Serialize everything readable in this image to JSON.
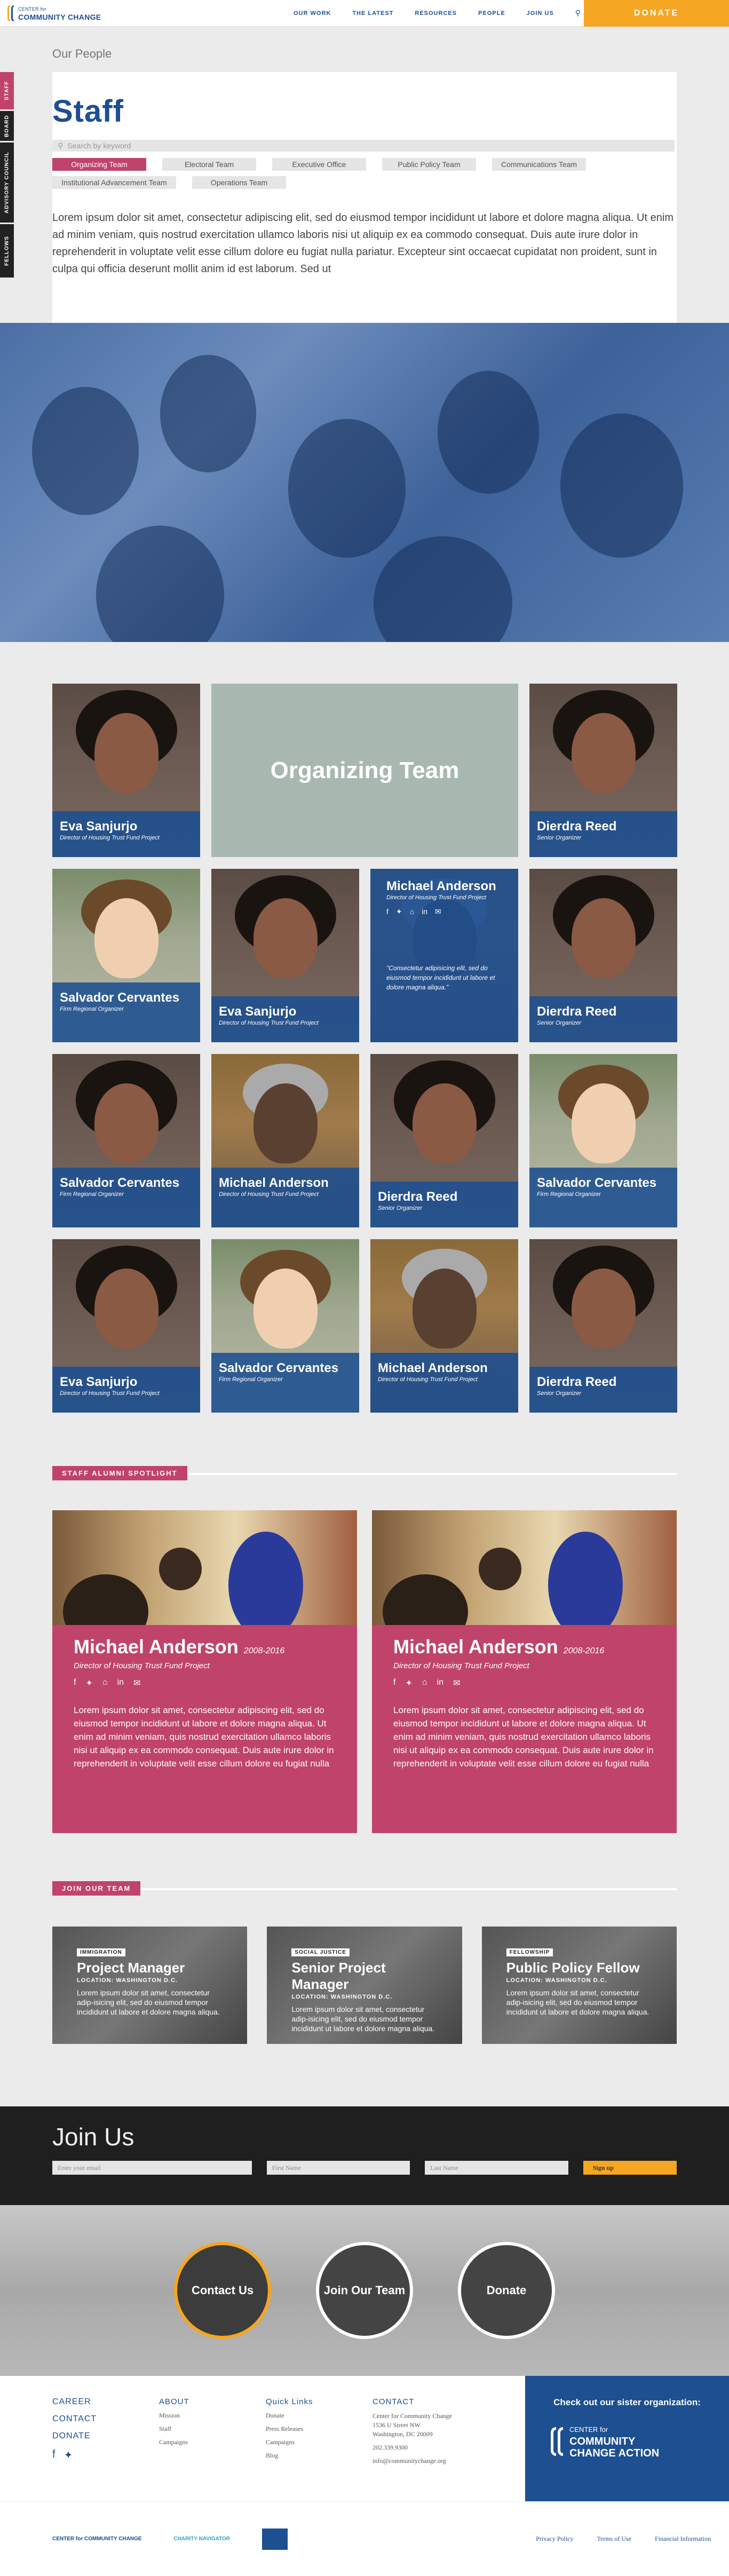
{
  "header": {
    "logo_line1": "CENTER for",
    "logo_line2": "COMMUNITY CHANGE",
    "nav": [
      "OUR WORK",
      "THE LATEST",
      "RESOURCES",
      "PEOPLE",
      "JOIN US"
    ],
    "donate_label": "DONATE"
  },
  "side_tabs": [
    "STAFF",
    "BOARD",
    "ADVISORY COUNCIL",
    "FELLOWS"
  ],
  "intro": {
    "breadcrumb": "Our People",
    "title": "Staff",
    "search_placeholder": "Search by keyword",
    "filters": [
      "Organizing Team",
      "Electoral Team",
      "Executive Office",
      "Public Policy Team",
      "Communications Team",
      "Institutional Advancement Team",
      "Operations Team"
    ],
    "body": "Lorem ipsum dolor sit amet, consectetur adipiscing elit, sed do eiusmod tempor incididunt ut labore et dolore magna aliqua. Ut enim ad minim veniam, quis nostrud exercitation ullamco laboris nisi ut aliquip ex ea commodo consequat. Duis aute irure dolor in reprehenderit in voluptate velit esse cillum dolore eu fugiat nulla pariatur. Excepteur sint occaecat cupidatat non proident, sunt in culpa qui officia deserunt mollit anim id est laborum. Sed ut"
  },
  "staff": {
    "team_title": "Organizing Team",
    "people": [
      {
        "name": "Eva Sanjurjo",
        "role": "Director of Housing Trust Fund Project"
      },
      {
        "name": "Dierdra Reed",
        "role": "Senior Organizer"
      },
      {
        "name": "Salvador Cervantes",
        "role": "Firm Regional Organizer"
      },
      {
        "name": "Eva Sanjurjo",
        "role": "Director of Housing Trust Fund Project"
      },
      {
        "name": "Michael Anderson",
        "role": "Director of Housing Trust Fund Project",
        "bio": "\"Consectetur adipisicing elit, sed do eiusmod tempor incididunt ut labore et dolore magna aliqua.\""
      },
      {
        "name": "Dierdra Reed",
        "role": "Senior Organizer"
      },
      {
        "name": "Salvador Cervantes",
        "role": "Firm Regional Organizer"
      },
      {
        "name": "Michael Anderson",
        "role": "Director of Housing Trust Fund Project"
      },
      {
        "name": "Dierdra Reed",
        "role": "Senior Organizer"
      },
      {
        "name": "Salvador Cervantes",
        "role": "Firm Regional Organizer"
      },
      {
        "name": "Eva Sanjurjo",
        "role": "Director of Housing Trust Fund Project"
      },
      {
        "name": "Salvador Cervantes",
        "role": "Firm Regional Organizer"
      },
      {
        "name": "Michael Anderson",
        "role": "Director of Housing Trust Fund Project"
      },
      {
        "name": "Dierdra Reed",
        "role": "Senior Organizer"
      }
    ]
  },
  "alumni": {
    "section_label": "STAFF ALUMNI SPOTLIGHT",
    "items": [
      {
        "name": "Michael Anderson",
        "years": "2008-2016",
        "role": "Director of Housing Trust Fund Project",
        "text": "Lorem ipsum dolor sit amet, consectetur adipiscing elit, sed do eiusmod tempor incididunt ut labore et dolore magna aliqua. Ut enim ad minim veniam, quis nostrud exercitation ullamco laboris nisi ut aliquip ex ea commodo consequat. Duis aute irure dolor in reprehenderit in voluptate velit esse cillum dolore eu fugiat nulla"
      },
      {
        "name": "Michael Anderson",
        "years": "2008-2016",
        "role": "Director of Housing Trust Fund Project",
        "text": "Lorem ipsum dolor sit amet, consectetur adipiscing elit, sed do eiusmod tempor incididunt ut labore et dolore magna aliqua. Ut enim ad minim veniam, quis nostrud exercitation ullamco laboris nisi ut aliquip ex ea commodo consequat. Duis aute irure dolor in reprehenderit in voluptate velit esse cillum dolore eu fugiat nulla"
      }
    ]
  },
  "jobs": {
    "section_label": "JOIN OUR TEAM",
    "items": [
      {
        "tag": "IMMIGRATION",
        "title": "Project Manager",
        "location": "LOCATION: WASHINGTON D.C.",
        "desc": "Lorem ipsum dolor sit amet, consectetur adip-isicing elit, sed do eiusmod tempor incididunt ut labore et dolore magna aliqua."
      },
      {
        "tag": "SOCIAL JUSTICE",
        "title": "Senior Project Manager",
        "location": "LOCATION: WASHINGTON D.C.",
        "desc": "Lorem ipsum dolor sit amet, consectetur adip-isicing elit, sed do eiusmod tempor incididunt ut labore et dolore magna aliqua."
      },
      {
        "tag": "FELLOWSHIP",
        "title": "Public Policy Fellow",
        "location": "LOCATION: WASHINGTON D.C.",
        "desc": "Lorem ipsum dolor sit amet, consectetur adip-isicing elit, sed do eiusmod tempor incididunt ut labore et dolore magna aliqua."
      }
    ]
  },
  "join": {
    "title": "Join Us",
    "email_placeholder": "Enter your email",
    "first_placeholder": "First Name",
    "last_placeholder": "Last Name",
    "signup_label": "Sign up"
  },
  "cta": {
    "contact": "Contact Us",
    "team": "Join Our Team",
    "donate": "Donate"
  },
  "footer": {
    "main_links": [
      "CAREER",
      "CONTACT",
      "DONATE"
    ],
    "about_head": "ABOUT",
    "about_links": [
      "Mission",
      "Staff",
      "Campaigns"
    ],
    "quick_head": "Quick Links",
    "quick_links": [
      "Donate",
      "Press Releases",
      "Campaigns",
      "Blog"
    ],
    "contact_head": "CONTACT",
    "address_lines": [
      "Center for Community Change",
      "1536 U Street NW",
      "Washington, DC 20009",
      "202.339.9300",
      "info@communitychange.org"
    ],
    "sister_head": "Check out our sister organization:",
    "sister_line1": "CENTER for",
    "sister_line2": "COMMUNITY",
    "sister_line3": "CHANGE ACTION",
    "bottom_logo1": "CENTER for COMMUNITY CHANGE",
    "bottom_logo2": "CHARITY NAVIGATOR",
    "bottom_links": [
      "Privacy Policy",
      "Terms of Use",
      "Financial Information"
    ]
  }
}
